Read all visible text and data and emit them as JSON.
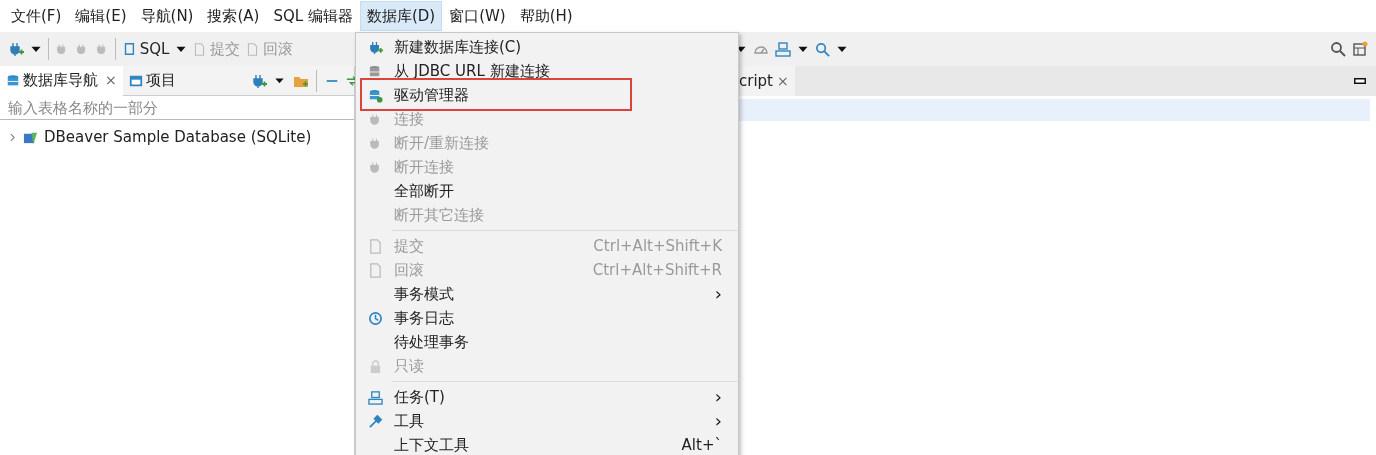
{
  "menubar": [
    {
      "label": "文件(F)",
      "selected": false
    },
    {
      "label": "编辑(E)",
      "selected": false
    },
    {
      "label": "导航(N)",
      "selected": false
    },
    {
      "label": "搜索(A)",
      "selected": false
    },
    {
      "label": "SQL 编辑器",
      "selected": false
    },
    {
      "label": "数据库(D)",
      "selected": true
    },
    {
      "label": "窗口(W)",
      "selected": false
    },
    {
      "label": "帮助(H)",
      "selected": false
    }
  ],
  "toolbar": {
    "sql_label": "SQL",
    "commit": "提交",
    "rollback": "回滚"
  },
  "navigator": {
    "tabs": [
      {
        "label": "数据库导航",
        "selected": true,
        "close": "×"
      },
      {
        "label": "项目",
        "selected": false
      }
    ],
    "filter": {
      "placeholder": "输入表格名称的一部分"
    },
    "tree": [
      {
        "label": "DBeaver Sample Database (SQLite)",
        "expanded": false
      }
    ]
  },
  "editor": {
    "tabs": [
      {
        "label": "cript",
        "close": "×",
        "selected": true
      }
    ]
  },
  "database_menu": {
    "items": [
      {
        "kind": "item",
        "label": "新建数据库连接(C)",
        "disabled": false
      },
      {
        "kind": "item",
        "label": "从 JDBC URL 新建连接",
        "disabled": false
      },
      {
        "kind": "item",
        "label": "驱动管理器",
        "disabled": false,
        "annotated": true
      },
      {
        "kind": "item",
        "label": "连接",
        "disabled": true
      },
      {
        "kind": "item",
        "label": "断开/重新连接",
        "disabled": true
      },
      {
        "kind": "item",
        "label": "断开连接",
        "disabled": true
      },
      {
        "kind": "item",
        "label": "全部断开",
        "disabled": false
      },
      {
        "kind": "item",
        "label": "断开其它连接",
        "disabled": true
      },
      {
        "kind": "separator"
      },
      {
        "kind": "item",
        "label": "提交",
        "disabled": true,
        "shortcut": "Ctrl+Alt+Shift+K"
      },
      {
        "kind": "item",
        "label": "回滚",
        "disabled": true,
        "shortcut": "Ctrl+Alt+Shift+R"
      },
      {
        "kind": "item",
        "label": "事务模式",
        "disabled": false,
        "arrow": "›"
      },
      {
        "kind": "item",
        "label": "事务日志",
        "disabled": false
      },
      {
        "kind": "item",
        "label": "待处理事务",
        "disabled": false
      },
      {
        "kind": "item",
        "label": "只读",
        "disabled": true
      },
      {
        "kind": "separator"
      },
      {
        "kind": "item",
        "label": "任务(T)",
        "disabled": false,
        "arrow": "›"
      },
      {
        "kind": "item",
        "label": "工具",
        "disabled": false,
        "arrow": "›"
      },
      {
        "kind": "item",
        "label": "上下文工具",
        "disabled": false,
        "shortcut": "Alt+`"
      }
    ]
  }
}
